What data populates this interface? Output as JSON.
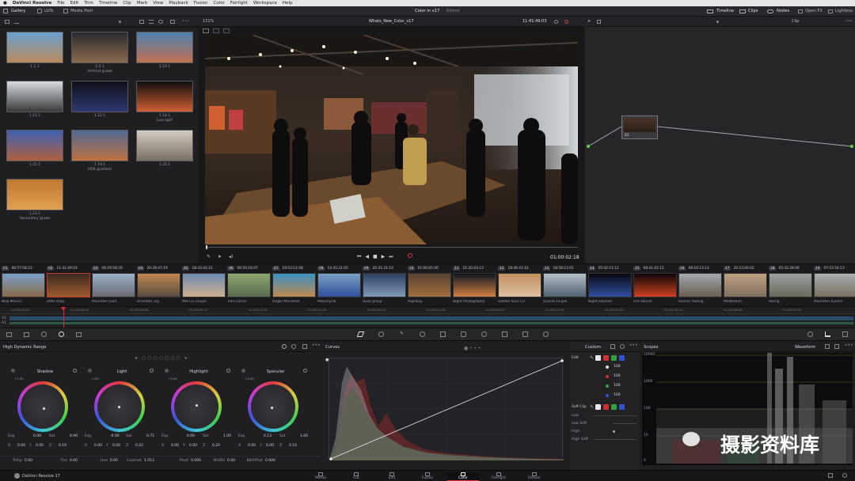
{
  "menubar": {
    "app": "DaVinci Resolve",
    "items": [
      "File",
      "Edit",
      "Trim",
      "Timeline",
      "Clip",
      "Mark",
      "View",
      "Playback",
      "Fusion",
      "Color",
      "Fairlight",
      "Workspace",
      "Help"
    ]
  },
  "toolbar": {
    "gallery": "Gallery",
    "luts": "LUTs",
    "media_pool": "Media Pool",
    "project_title": "Color in v17",
    "project_status": "Edited",
    "timeline_btn": "Timeline",
    "clips_btn": "Clips",
    "nodes_btn": "Nodes",
    "openfx_btn": "Open FX",
    "lightbox_btn": "Lightbox"
  },
  "viewer_bar": {
    "zoom": "131%",
    "timeline_name": "Whats_New_Color_v17",
    "timecode": "11:41:49:03",
    "node_mode": "Clip"
  },
  "gallery": {
    "stills": [
      {
        "label": "1.1.1",
        "sub": "",
        "colors": [
          "#6aa0d0",
          "#b98a5a"
        ]
      },
      {
        "label": "1.4.1",
        "sub": "Vertical grade",
        "colors": [
          "#2a2a30",
          "#8a6a50"
        ]
      },
      {
        "label": "1.10.1",
        "sub": "",
        "colors": [
          "#4f7fb0",
          "#c07050"
        ]
      },
      {
        "label": "1.11.1",
        "sub": "",
        "colors": [
          "#d8dde2",
          "#3a3a3a"
        ]
      },
      {
        "label": "1.12.1",
        "sub": "",
        "colors": [
          "#101018",
          "#2a3a70"
        ]
      },
      {
        "label": "1.14.1",
        "sub": "Low light",
        "colors": [
          "#0e0e10",
          "#d06030"
        ]
      },
      {
        "label": "1.15.1",
        "sub": "",
        "colors": [
          "#4060b0",
          "#b06040"
        ]
      },
      {
        "label": "1.19.1",
        "sub": "HDR gradient",
        "colors": [
          "#506a90",
          "#c07040"
        ]
      },
      {
        "label": "1.20.1",
        "sub": "",
        "colors": [
          "#d0ccc0",
          "#7a7060"
        ]
      },
      {
        "label": "1.23.1",
        "sub": "Secondary grade",
        "colors": [
          "#c07830",
          "#e0a050"
        ]
      }
    ]
  },
  "transport": {
    "timecode": "01:00:02:18"
  },
  "clips": [
    {
      "num": "01",
      "tc": "06:57:58:23",
      "track": "V1",
      "label": "New Mexico",
      "colors": [
        "#7aa0c8",
        "#8a6a4a"
      ]
    },
    {
      "num": "02",
      "tc": "11:41:49:03",
      "track": "V1",
      "label": "DMO shop",
      "colors": [
        "#3a2a20",
        "#a05a30"
      ]
    },
    {
      "num": "03",
      "tc": "06:29:58:20",
      "track": "V1",
      "label": "Mountain road",
      "colors": [
        "#9ab0c8",
        "#6a6a70"
      ]
    },
    {
      "num": "04",
      "tc": "20:39:47:19",
      "track": "V1",
      "label": "Dramatic sky",
      "colors": [
        "#c08850",
        "#5a4a40"
      ]
    },
    {
      "num": "05",
      "tc": "18:43:42:21",
      "track": "V1",
      "label": "Mid CU couple",
      "colors": [
        "#6a8ab0",
        "#d0b090"
      ]
    },
    {
      "num": "06",
      "tc": "06:50:18:07",
      "track": "V1",
      "label": "Trail runner",
      "colors": [
        "#8aa870",
        "#5a6a50"
      ]
    },
    {
      "num": "07",
      "tc": "19:53:12:08",
      "track": "V1",
      "label": "Organ Mountain",
      "colors": [
        "#3a90c0",
        "#c08a50"
      ]
    },
    {
      "num": "08",
      "tc": "14:45:31:05",
      "track": "V1",
      "label": "Motorcycle",
      "colors": [
        "#7aa0c0",
        "#3050a0"
      ]
    },
    {
      "num": "09",
      "tc": "20:31:31:10",
      "track": "V1",
      "label": "Dusk group",
      "colors": [
        "#304060",
        "#809ab8"
      ]
    },
    {
      "num": "10",
      "tc": "01:00:05:00",
      "track": "V1",
      "label": "Highway",
      "colors": [
        "#5a4030",
        "#a07040"
      ]
    },
    {
      "num": "11",
      "tc": "21:20:43:13",
      "track": "V1",
      "label": "Night Photography",
      "colors": [
        "#101520",
        "#d08040"
      ]
    },
    {
      "num": "12",
      "tc": "18:46:41:16",
      "track": "V1",
      "label": "Golden hour CU",
      "colors": [
        "#c09060",
        "#e0c0a0"
      ]
    },
    {
      "num": "13",
      "tc": "18:58:23:01",
      "track": "V1",
      "label": "Sunset couple",
      "colors": [
        "#b0c0c8",
        "#506070"
      ]
    },
    {
      "num": "14",
      "tc": "05:42:11:12",
      "track": "V1",
      "label": "Night explorer",
      "colors": [
        "#080810",
        "#3050a0"
      ]
    },
    {
      "num": "15",
      "tc": "08:41:41:12",
      "track": "V1",
      "label": "Fire dancer",
      "colors": [
        "#0c0608",
        "#d04020"
      ]
    },
    {
      "num": "16",
      "tc": "08:16:13:13",
      "track": "V1",
      "label": "Runner resting",
      "colors": [
        "#a0a8b0",
        "#6a6050"
      ]
    },
    {
      "num": "17",
      "tc": "20:23:00:02",
      "track": "V1",
      "label": "Meditation",
      "colors": [
        "#c0a080",
        "#807060"
      ]
    },
    {
      "num": "18",
      "tc": "05:42:28:06",
      "track": "V1",
      "label": "Hiking",
      "colors": [
        "#9aa0a0",
        "#6a6a5a"
      ]
    },
    {
      "num": "19",
      "tc": "07:52:54:13",
      "track": "V1",
      "label": "Mountain Runner",
      "colors": [
        "#a8b0b0",
        "#7a7060"
      ]
    }
  ],
  "timeline": {
    "track_v": "V1",
    "track_a": "A1",
    "ticks": [
      "01:00:00:00",
      "01:00:03:04",
      "01:00:06:08",
      "01:00:09:12",
      "01:00:12:16",
      "01:00:15:20",
      "01:00:18:24",
      "01:00:21:28",
      "01:00:24:32",
      "01:00:27:36",
      "01:00:30:40",
      "01:00:33:44",
      "01:00:36:48",
      "01:00:39:52"
    ]
  },
  "hdr": {
    "title": "High Dynamic Range",
    "wheels": [
      {
        "name": "Shadow",
        "exp_val": "+1.50",
        "exp": "0.00",
        "sat": "0.90",
        "x": "0.00",
        "y": "0.00",
        "z": "0.19"
      },
      {
        "name": "Light",
        "exp_val": "-1.00",
        "exp": "-0.00",
        "sat": "0.71",
        "x": "0.00",
        "y": "0.00",
        "z": "0.22"
      },
      {
        "name": "Highlight",
        "exp_val": "+1.50",
        "exp": "0.00",
        "sat": "1.00",
        "x": "0.00",
        "y": "0.00",
        "z": "0.20"
      },
      {
        "name": "Specular",
        "exp_val": "+4.00",
        "exp": "0.13",
        "sat": "1.00",
        "x": "0.00",
        "y": "0.00",
        "z": "0.10"
      }
    ],
    "labels": {
      "exp": "Exp",
      "sat": "Sat",
      "x": "X",
      "y": "Y",
      "z": "Z"
    },
    "bottom": [
      {
        "label": "Temp",
        "value": "0.00"
      },
      {
        "label": "Tint",
        "value": "0.00"
      },
      {
        "label": "Hue",
        "value": "0.00"
      },
      {
        "label": "Contrast",
        "value": "1.013"
      },
      {
        "label": "Pivot",
        "value": "0.000"
      },
      {
        "label": "MidDtl",
        "value": "0.00"
      },
      {
        "label": "BlkOffset",
        "value": "0.000"
      }
    ]
  },
  "curves": {
    "title": "Curves",
    "mode": "Custom"
  },
  "edit_panel": {
    "title": "Edit",
    "values": [
      "100",
      "100",
      "100",
      "100"
    ],
    "softclip_title": "Soft Clip",
    "softclip_items": [
      "Low",
      "Low Soft",
      "High",
      "High Soft"
    ]
  },
  "scopes": {
    "title": "Scopes",
    "mode": "Waveform",
    "ticks": [
      "10000",
      "1000",
      "100",
      "10",
      "0"
    ]
  },
  "bottombar": {
    "app": "DaVinci Resolve 17",
    "tabs": [
      {
        "label": "Media",
        "active": false
      },
      {
        "label": "Cut",
        "active": false
      },
      {
        "label": "Edit",
        "active": false
      },
      {
        "label": "Fusion",
        "active": false
      },
      {
        "label": "Color",
        "active": true
      },
      {
        "label": "Fairlight",
        "active": false
      },
      {
        "label": "Deliver",
        "active": false
      }
    ]
  },
  "watermark": "摄影资料库",
  "colors": {
    "accent": "#e03434",
    "playhead": "#d82a2a",
    "selected_clip": "#c0392b"
  }
}
